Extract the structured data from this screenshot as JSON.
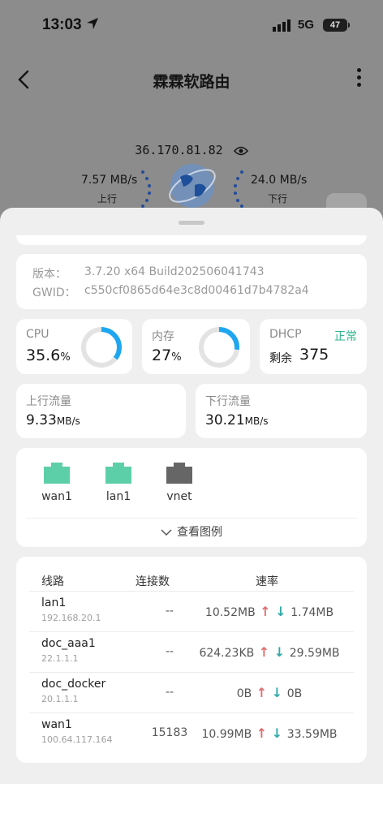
{
  "status_bar": {
    "time": "13:03",
    "network": "5G",
    "battery": "47"
  },
  "header": {
    "title": "霖霖软路由"
  },
  "overview": {
    "ip": "36.170.81.82",
    "upload_speed": "7.57 MB/s",
    "upload_label": "上行",
    "download_speed": "24.0 MB/s",
    "download_label": "下行"
  },
  "version": {
    "version_label": "版本：",
    "version_value": "3.7.20 x64 Build202506041743",
    "gwid_label": "GWID：",
    "gwid_value": "c550cf0865d64e3c8d00461d7b4782a4"
  },
  "cpu": {
    "label": "CPU",
    "value": "35.6",
    "unit": "%",
    "usage_fraction": 0.356
  },
  "memory": {
    "label": "内存",
    "value": "27",
    "unit": "%",
    "usage_fraction": 0.27
  },
  "dhcp": {
    "label": "DHCP",
    "status": "正常",
    "remaining_label": "剩余",
    "remaining_value": "375"
  },
  "traffic": {
    "up_label": "上行流量",
    "up_value": "9.33",
    "up_unit": "MB/s",
    "down_label": "下行流量",
    "down_value": "30.21",
    "down_unit": "MB/s"
  },
  "interfaces": [
    {
      "name": "wan1",
      "icon": "ethernet-port-icon",
      "color": "#5ccfa8"
    },
    {
      "name": "lan1",
      "icon": "ethernet-port-icon",
      "color": "#5ccfa8"
    },
    {
      "name": "vnet",
      "icon": "ethernet-port-icon",
      "color": "#666666"
    }
  ],
  "legend_toggle": "查看图例",
  "lines_table": {
    "headers": [
      "线路",
      "连接数",
      "速率"
    ],
    "rows": [
      {
        "name": "lan1",
        "ip": "192.168.20.1",
        "connections": "--",
        "up": "10.52MB",
        "down": "1.74MB"
      },
      {
        "name": "doc_aaa1",
        "ip": "22.1.1.1",
        "connections": "--",
        "up": "624.23KB",
        "down": "29.59MB"
      },
      {
        "name": "doc_docker",
        "ip": "20.1.1.1",
        "connections": "--",
        "up": "0B",
        "down": "0B"
      },
      {
        "name": "wan1",
        "ip": "100.64.117.164",
        "connections": "15183",
        "up": "10.99MB",
        "down": "33.59MB"
      }
    ]
  },
  "colors": {
    "accent": "#2fb48e",
    "up_arrow": "#e26d6d",
    "down_arrow": "#2fa9a9",
    "ring_fill": "#1ea7f0"
  }
}
